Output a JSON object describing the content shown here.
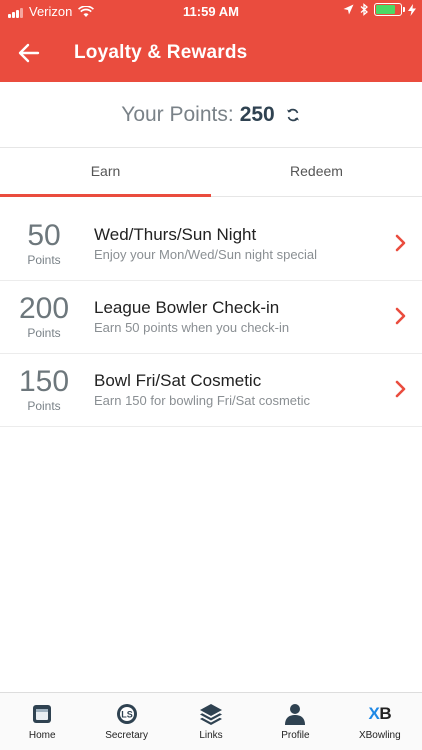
{
  "status_bar": {
    "carrier": "Verizon",
    "time": "11:59 AM",
    "battery_level": 0.8,
    "icons": [
      "signal-icon",
      "wifi-icon",
      "location-icon",
      "bluetooth-icon",
      "battery-icon",
      "charging-icon"
    ]
  },
  "header": {
    "title": "Loyalty & Rewards",
    "back_icon": "back-arrow-icon"
  },
  "points": {
    "label": "Your Points:",
    "value": "250",
    "refresh_icon": "refresh-icon"
  },
  "tabs": [
    {
      "label": "Earn",
      "active": true
    },
    {
      "label": "Redeem",
      "active": false
    }
  ],
  "rewards": [
    {
      "points": "50",
      "unit": "Points",
      "title": "Wed/Thurs/Sun Night",
      "subtitle": "Enjoy your Mon/Wed/Sun night special"
    },
    {
      "points": "200",
      "unit": "Points",
      "title": "League Bowler Check-in",
      "subtitle": "Earn 50 points when you check-in"
    },
    {
      "points": "150",
      "unit": "Points",
      "title": "Bowl Fri/Sat Cosmetic",
      "subtitle": "Earn 150 for bowling Fri/Sat cosmetic"
    }
  ],
  "tab_bar": {
    "items": [
      {
        "label": "Home",
        "icon": "home-icon"
      },
      {
        "label": "Secretary",
        "icon": "secretary-icon"
      },
      {
        "label": "Links",
        "icon": "layers-icon"
      },
      {
        "label": "Profile",
        "icon": "person-icon"
      },
      {
        "label": "XBowling",
        "icon": "xbowling-logo",
        "logo_text_x": "X",
        "logo_text_b": "B"
      }
    ]
  },
  "colors": {
    "accent": "#ea4c3e",
    "points_value": "#2f4251",
    "xbowling_blue": "#1e88e5"
  }
}
